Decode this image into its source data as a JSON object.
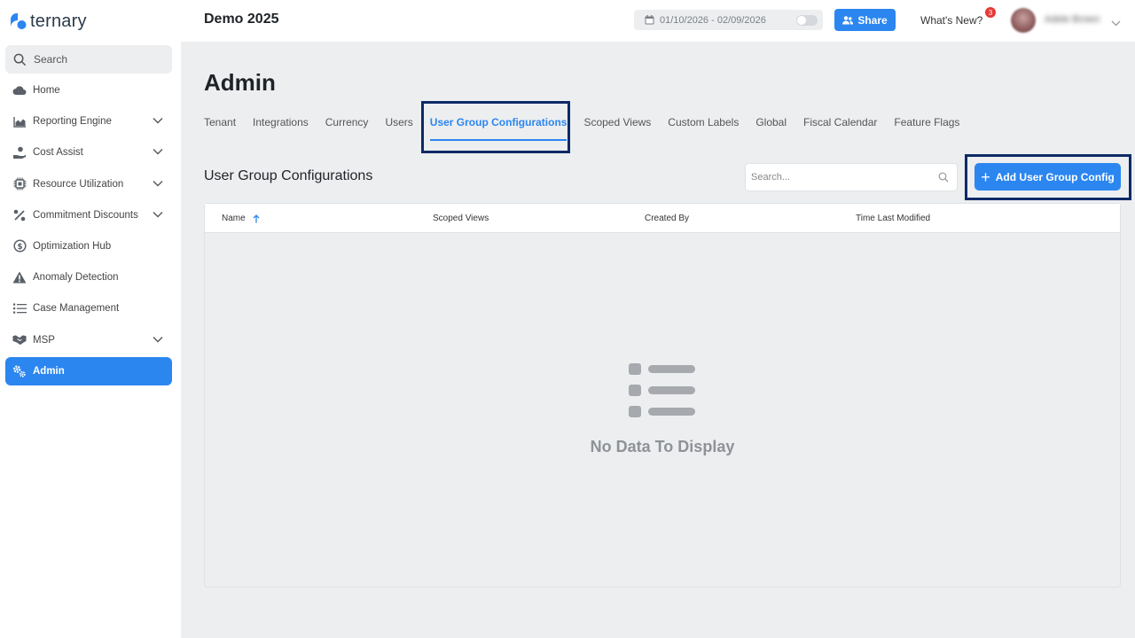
{
  "brand": {
    "name": "ternary",
    "color": "#2b86f0"
  },
  "sidebar": {
    "search_label": "Search",
    "items": [
      {
        "label": "Home",
        "icon": "cloud-icon"
      },
      {
        "label": "Reporting Engine",
        "icon": "area-chart-icon",
        "expandable": true
      },
      {
        "label": "Cost Assist",
        "icon": "hand-coins-icon",
        "expandable": true
      },
      {
        "label": "Resource Utilization",
        "icon": "chip-icon",
        "expandable": true
      },
      {
        "label": "Commitment Discounts",
        "icon": "percent-icon",
        "expandable": true
      },
      {
        "label": "Optimization Hub",
        "icon": "dollar-circle-icon"
      },
      {
        "label": "Anomaly Detection",
        "icon": "warning-icon"
      },
      {
        "label": "Case Management",
        "icon": "list-icon"
      },
      {
        "label": "MSP",
        "icon": "handshake-icon",
        "expandable": true
      },
      {
        "label": "Admin",
        "icon": "gears-icon",
        "active": true
      }
    ]
  },
  "header": {
    "project_title": "Demo 2025",
    "date_range": "01/10/2026 - 02/09/2026",
    "share_label": "Share",
    "whats_new_label": "What's New?",
    "notification_count": "3",
    "user_name": "Adele Brown"
  },
  "main": {
    "page_title": "Admin",
    "tabs": [
      {
        "label": "Tenant"
      },
      {
        "label": "Integrations"
      },
      {
        "label": "Currency"
      },
      {
        "label": "Users"
      },
      {
        "label": "User Group Configurations",
        "active": true
      },
      {
        "label": "Scoped Views"
      },
      {
        "label": "Custom Labels"
      },
      {
        "label": "Global"
      },
      {
        "label": "Fiscal Calendar"
      },
      {
        "label": "Feature Flags"
      }
    ],
    "section_title": "User Group Configurations",
    "search_placeholder": "Search...",
    "add_button_label": "Add User Group Config",
    "table": {
      "columns": [
        "Name",
        "Scoped Views",
        "Created By",
        "Time Last Modified"
      ],
      "sorted_column": "Name",
      "sort_direction": "ascending",
      "empty_message": "No Data To Display"
    }
  }
}
